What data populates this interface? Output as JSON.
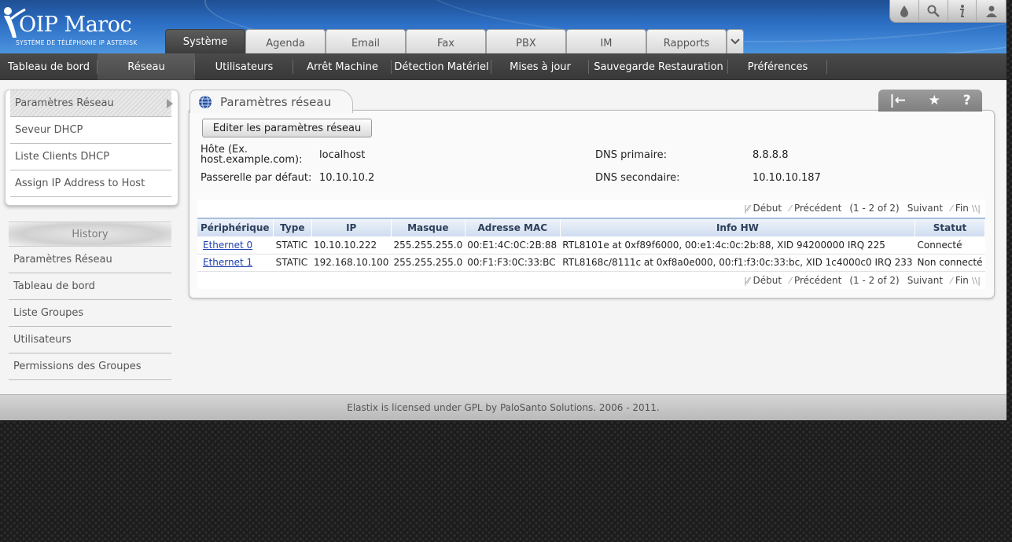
{
  "brand": {
    "logo_text": "OIP Maroc",
    "logo_sub": "SYSTÈME DE TÉLÉPHONIE IP ASTERISK"
  },
  "top_icons": [
    "theme-drop-icon",
    "search-icon",
    "info-icon",
    "user-icon"
  ],
  "tabs": [
    {
      "label": "Système",
      "active": true
    },
    {
      "label": "Agenda"
    },
    {
      "label": "Email"
    },
    {
      "label": "Fax"
    },
    {
      "label": "PBX"
    },
    {
      "label": "IM"
    },
    {
      "label": "Rapports"
    }
  ],
  "subnav": [
    {
      "label": "Tableau de bord"
    },
    {
      "label": "Réseau",
      "active": true
    },
    {
      "label": "Utilisateurs"
    },
    {
      "label": "Arrêt Machine"
    },
    {
      "label": "Détection Matériel"
    },
    {
      "label": "Mises à jour"
    },
    {
      "label": "Sauvegarde Restauration"
    },
    {
      "label": "Préférences"
    }
  ],
  "left_menu": [
    {
      "label": "Paramètres Réseau",
      "active": true
    },
    {
      "label": "Seveur DHCP"
    },
    {
      "label": "Liste Clients DHCP"
    },
    {
      "label": "Assign IP Address to Host"
    }
  ],
  "history": {
    "title": "History",
    "items": [
      "Paramètres Réseau",
      "Tableau de bord",
      "Liste Groupes",
      "Utilisateurs",
      "Permissions des Groupes"
    ]
  },
  "panel": {
    "title": "Paramètres réseau",
    "tools": [
      "|←",
      "★",
      "?"
    ],
    "edit_button": "Editer les paramètres réseau"
  },
  "network": {
    "host_label_1": "Hôte (Ex.",
    "host_label_2": "host.example.com):",
    "host_value": "localhost",
    "gateway_label": "Passerelle par défaut:",
    "gateway_value": "10.10.10.2",
    "dns1_label": "DNS primaire:",
    "dns1_value": "8.8.8.8",
    "dns2_label": "DNS secondaire:",
    "dns2_value": "10.10.10.187"
  },
  "pager": {
    "start": "Début",
    "prev": "Précédent",
    "range": "(1 - 2 of 2)",
    "next": "Suivant",
    "end": "Fin"
  },
  "table": {
    "columns": [
      "Périphérique",
      "Type",
      "IP",
      "Masque",
      "Adresse MAC",
      "Info HW",
      "Statut"
    ],
    "rows": [
      {
        "device": "Ethernet 0",
        "type": "STATIC",
        "ip": "10.10.10.222",
        "mask": "255.255.255.0",
        "mac": "00:E1:4C:0C:2B:88",
        "hw": "RTL8101e at 0xf89f6000, 00:e1:4c:0c:2b:88, XID 94200000 IRQ 225",
        "status": "Connecté"
      },
      {
        "device": "Ethernet 1",
        "type": "STATIC",
        "ip": "192.168.10.100",
        "mask": "255.255.255.0",
        "mac": "00:F1:F3:0C:33:BC",
        "hw": "RTL8168c/8111c at 0xf8a0e000, 00:f1:f3:0c:33:bc, XID 1c4000c0 IRQ 233",
        "status": "Non connecté"
      }
    ]
  },
  "footer": "Elastix is licensed under GPL by PaloSanto Solutions. 2006 - 2011.",
  "colors": {
    "status_ok": "#1c8b1c",
    "status_bad": "#d01818",
    "header_blue": "#2c6fc5"
  }
}
